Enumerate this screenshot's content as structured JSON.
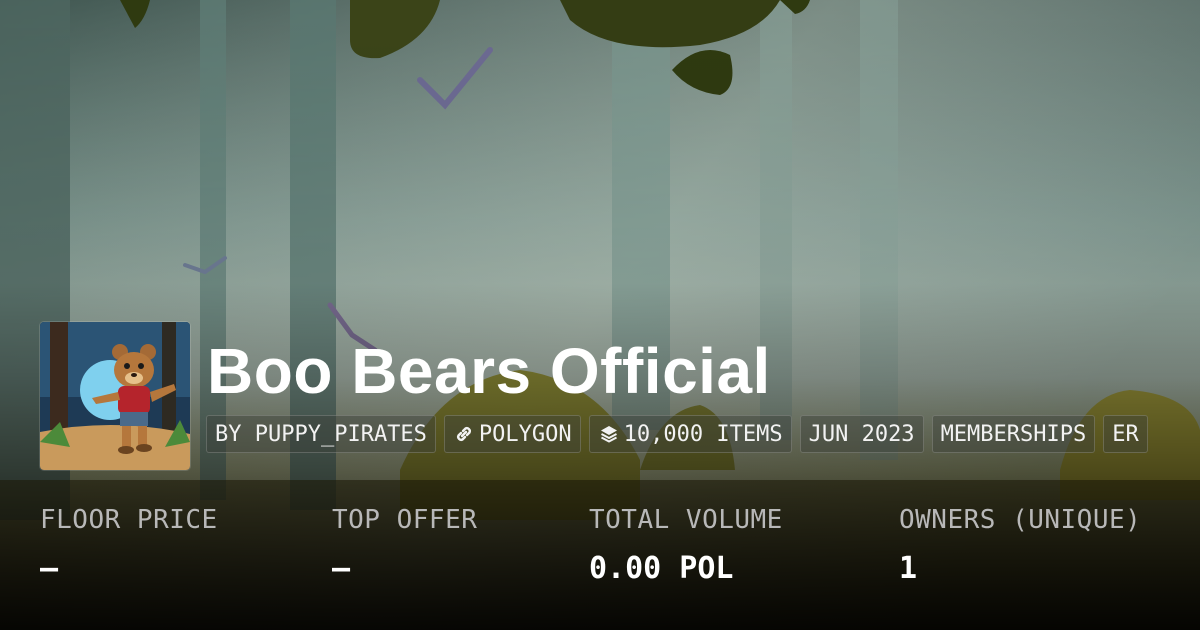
{
  "collection": {
    "name": "Boo Bears Official",
    "avatar_icon": "bear-avatar-image"
  },
  "chips": [
    {
      "label": "BY PUPPY_PIRATES",
      "icon": ""
    },
    {
      "label": "POLYGON",
      "icon": "chain-link-icon"
    },
    {
      "label": "10,000 ITEMS",
      "icon": "layers-icon"
    },
    {
      "label": "JUN 2023",
      "icon": ""
    },
    {
      "label": "MEMBERSHIPS",
      "icon": ""
    },
    {
      "label": "ER",
      "icon": ""
    }
  ],
  "stats": [
    {
      "label": "FLOOR PRICE",
      "value": "–"
    },
    {
      "label": "TOP OFFER",
      "value": "–"
    },
    {
      "label": "TOTAL VOLUME",
      "value": "0.00 POL"
    },
    {
      "label": "OWNERS (UNIQUE)",
      "value": "1"
    }
  ],
  "colors": {
    "text": "#ffffff",
    "muted_label": "#b8b8b8",
    "forest_sky": "#8fa39a",
    "forest_floor": "#a59a2c",
    "leaf": "#3b4418"
  }
}
